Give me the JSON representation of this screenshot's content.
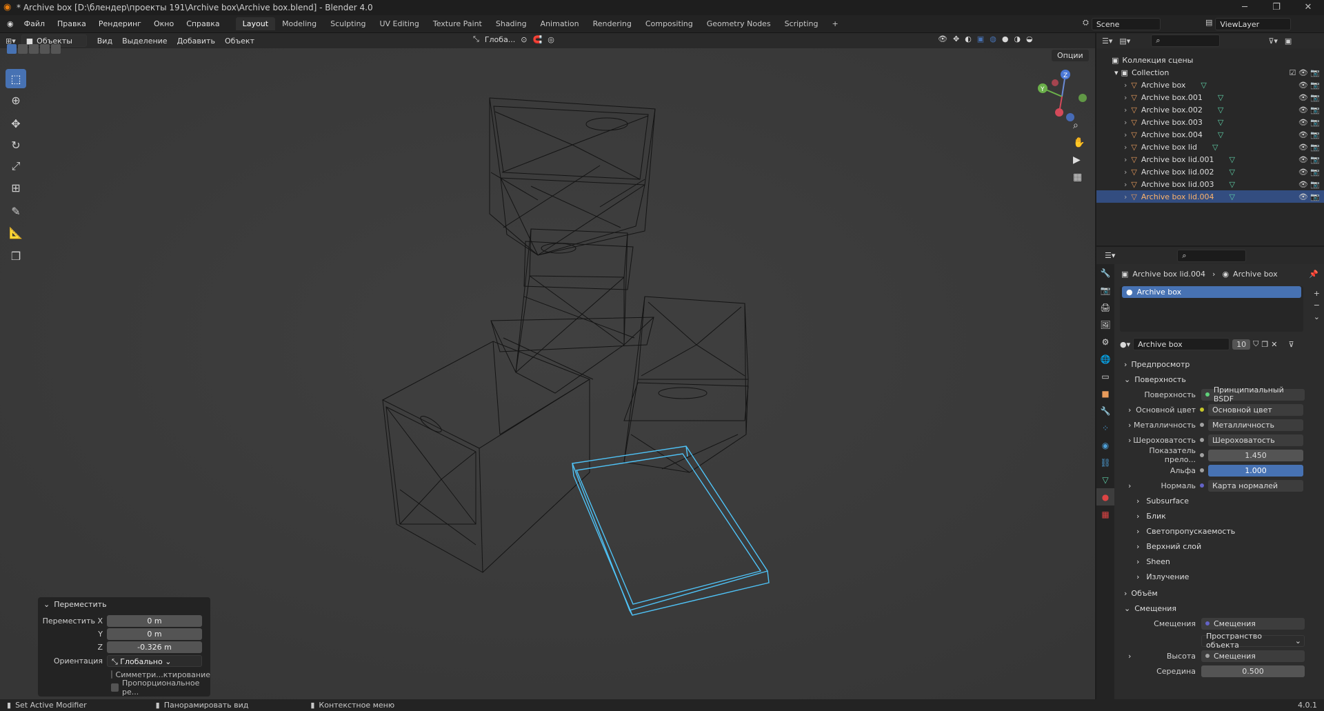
{
  "window": {
    "title": "* Archive box [D:\\блендер\\проекты 191\\Archive box\\Archive box.blend] - Blender 4.0"
  },
  "menu": [
    "Файл",
    "Правка",
    "Рендеринг",
    "Окно",
    "Справка"
  ],
  "workspaces": [
    "Layout",
    "Modeling",
    "Sculpting",
    "UV Editing",
    "Texture Paint",
    "Shading",
    "Animation",
    "Rendering",
    "Compositing",
    "Geometry Nodes",
    "Scripting"
  ],
  "scene": "Scene",
  "view_layer": "ViewLayer",
  "viewport_header": {
    "mode": "Объекты",
    "menus": [
      "Вид",
      "Выделение",
      "Добавить",
      "Объект"
    ],
    "orientation": "Глоба...",
    "options": "Опции"
  },
  "operator_panel": {
    "title": "Переместить",
    "x_label": "Переместить X",
    "x": "0 m",
    "y_label": "Y",
    "y": "0 m",
    "z_label": "Z",
    "z": "-0.326 m",
    "orient_label": "Ориентация",
    "orient": "Глобально",
    "sym": "Симметри...ктирование",
    "prop": "Пропорциональное ре..."
  },
  "outliner": {
    "root": "Коллекция сцены",
    "collection": "Collection",
    "objects": [
      "Archive box",
      "Archive box.001",
      "Archive box.002",
      "Archive box.003",
      "Archive box.004",
      "Archive box lid",
      "Archive box lid.001",
      "Archive box lid.002",
      "Archive box lid.003",
      "Archive box lid.004"
    ],
    "selected_index": 9
  },
  "properties": {
    "breadcrumb_object": "Archive box lid.004",
    "breadcrumb_material": "Archive box",
    "slot": "Archive box",
    "material_name": "Archive box",
    "users": "10",
    "sections": {
      "preview": "Предпросмотр",
      "surface": "Поверхность",
      "volume": "Объём",
      "displacement": "Смещения"
    },
    "surface_label": "Поверхность",
    "surface_value": "Принципиальный BSDF",
    "inputs": [
      {
        "label": "Основной цвет",
        "value": "Основной цвет",
        "dot": "#c7c729",
        "expand": true
      },
      {
        "label": "Металличность",
        "value": "Металличность",
        "dot": "#a1a1a1",
        "expand": true
      },
      {
        "label": "Шероховатость",
        "value": "Шероховатость",
        "dot": "#a1a1a1",
        "expand": true
      },
      {
        "label": "Показатель прело...",
        "value": "1.450",
        "dot": "#a1a1a1",
        "num": true
      },
      {
        "label": "Альфа",
        "value": "1.000",
        "dot": "#a1a1a1",
        "blue": true
      },
      {
        "label": "Нормаль",
        "value": "Карта нормалей",
        "dot": "#6363c7",
        "expand": true
      }
    ],
    "subpanels": [
      "Subsurface",
      "Блик",
      "Светопропускаемость",
      "Верхний слой",
      "Sheen",
      "Излучение"
    ],
    "disp_label": "Смещения",
    "disp_value": "Смещения",
    "space": "Пространство объекта",
    "height_label": "Высота",
    "height_value": "Смещения",
    "mid_label": "Середина",
    "mid_value": "0.500"
  },
  "status": {
    "left": "Set Active Modifier",
    "mid": "Панорамировать вид",
    "right": "Контекстное меню",
    "version": "4.0.1"
  },
  "colors": {
    "accent": "#4772b3",
    "selection_wire": "#4fc3f7",
    "object_icon": "#e89b5b",
    "mesh_icon": "#5fd1a8"
  }
}
